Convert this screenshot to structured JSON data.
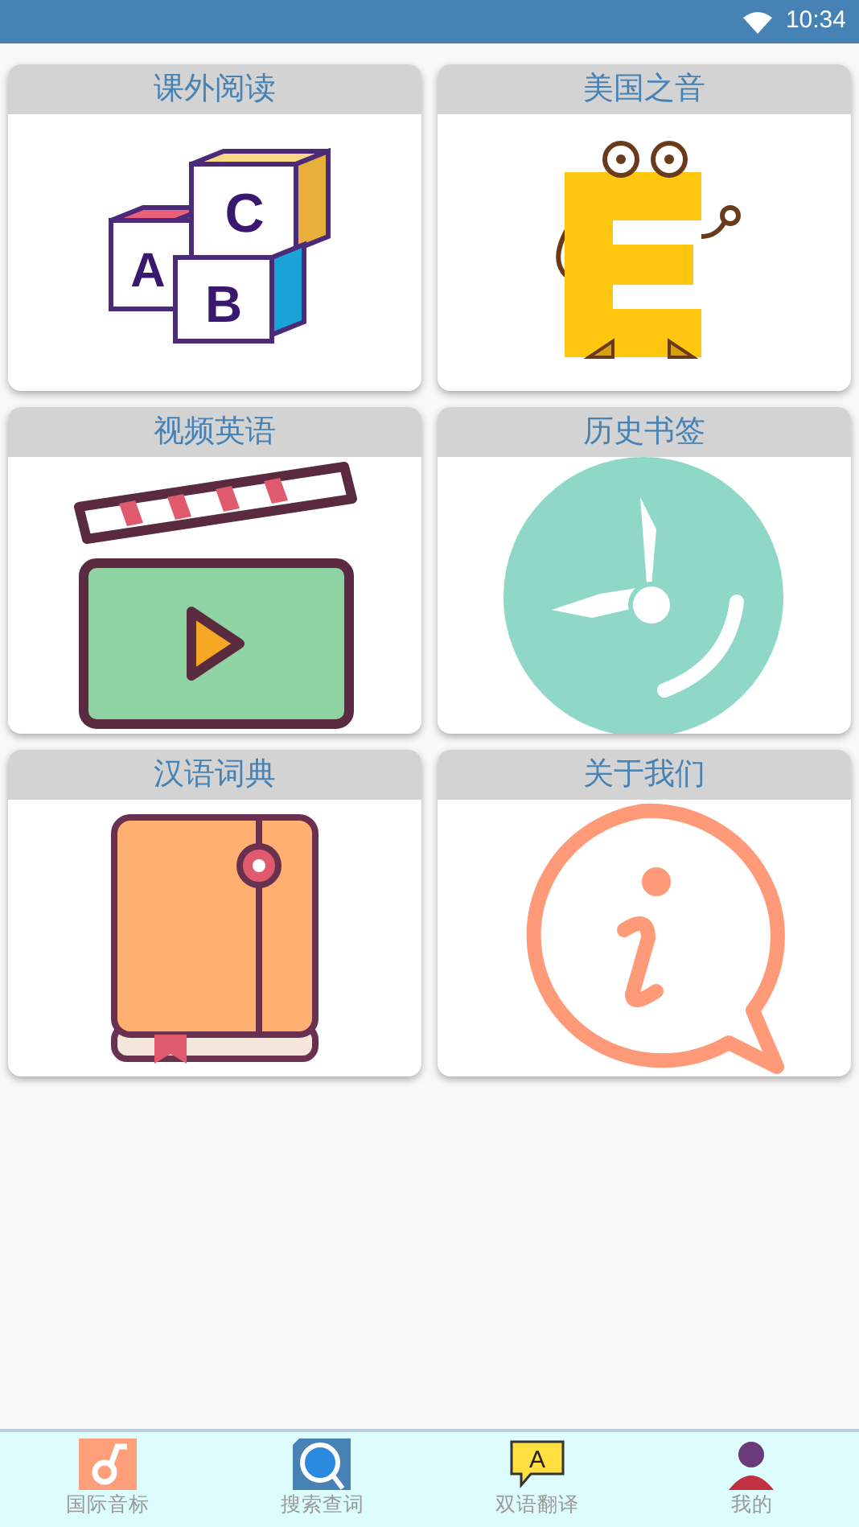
{
  "status_bar": {
    "time": "10:34"
  },
  "cards": [
    {
      "title": "课外阅读",
      "kind": "blocks",
      "letters": [
        "C",
        "A",
        "B"
      ]
    },
    {
      "title": "美国之音",
      "kind": "mascot"
    },
    {
      "title": "视频英语",
      "kind": "clapper"
    },
    {
      "title": "历史书签",
      "kind": "clock"
    },
    {
      "title": "汉语词典",
      "kind": "book"
    },
    {
      "title": "关于我们",
      "kind": "info"
    }
  ],
  "bottom_nav": [
    {
      "label": "国际音标",
      "kind": "note"
    },
    {
      "label": "搜索查词",
      "kind": "search"
    },
    {
      "label": "双语翻译",
      "kind": "bubble",
      "badge": "A"
    },
    {
      "label": "我的",
      "kind": "person"
    }
  ]
}
